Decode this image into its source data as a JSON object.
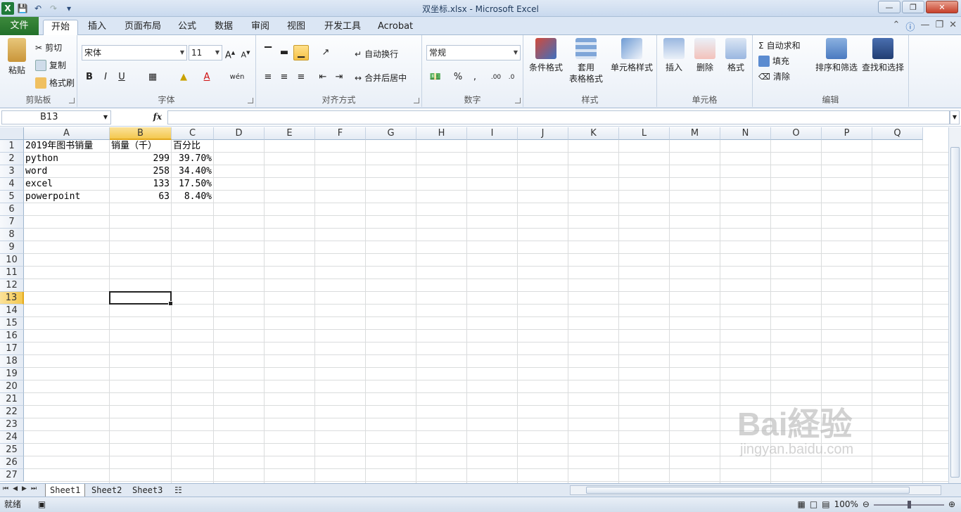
{
  "window": {
    "title": "双坐标.xlsx  -  Microsoft Excel"
  },
  "tabs": [
    "文件",
    "开始",
    "插入",
    "页面布局",
    "公式",
    "数据",
    "审阅",
    "视图",
    "开发工具",
    "Acrobat"
  ],
  "ribbon": {
    "clipboard": {
      "paste": "粘贴",
      "cut": "剪切",
      "copy": "复制",
      "format_painter": "格式刷",
      "label": "剪贴板"
    },
    "font": {
      "name": "宋体",
      "size": "11",
      "label": "字体"
    },
    "alignment": {
      "wrap": "自动换行",
      "merge": "合并后居中",
      "label": "对齐方式"
    },
    "number": {
      "format": "常规",
      "percent": "%",
      "comma": ",",
      "label": "数字"
    },
    "styles": {
      "cond": "条件格式",
      "table1": "套用",
      "table2": "表格格式",
      "cell": "单元格样式",
      "label": "样式"
    },
    "cells": {
      "insert": "插入",
      "delete": "删除",
      "format": "格式",
      "label": "单元格"
    },
    "editing": {
      "autosum": "自动求和",
      "fill": "填充",
      "clear": "清除",
      "sort": "排序和筛选",
      "find": "查找和选择",
      "label": "编辑"
    }
  },
  "formula_bar": {
    "name_box": "B13",
    "fx": "fx",
    "value": ""
  },
  "columns": [
    "A",
    "B",
    "C",
    "D",
    "E",
    "F",
    "G",
    "H",
    "I",
    "J",
    "K",
    "L",
    "M",
    "N",
    "O",
    "P",
    "Q"
  ],
  "rows": [
    "1",
    "2",
    "3",
    "4",
    "5",
    "6",
    "7",
    "8",
    "9",
    "10",
    "11",
    "12",
    "13",
    "14",
    "15",
    "16",
    "17",
    "18",
    "19",
    "20",
    "21",
    "22",
    "23",
    "24",
    "25",
    "26",
    "27"
  ],
  "selected": {
    "column": "B",
    "row": "13"
  },
  "cells": {
    "A1": "2019年图书销量",
    "B1": "销量（千）",
    "C1": "百分比",
    "A2": "python",
    "B2": "299",
    "C2": "39.70%",
    "A3": "word",
    "B3": "258",
    "C3": "34.40%",
    "A4": "excel",
    "B4": "133",
    "C4": "17.50%",
    "A5": "powerpoint",
    "B5": "63",
    "C5": "8.40%"
  },
  "sheets": [
    "Sheet1",
    "Sheet2",
    "Sheet3"
  ],
  "active_sheet": "Sheet1",
  "status": {
    "ready": "就绪",
    "zoom": "100%"
  },
  "watermark": {
    "main": "Bai経验",
    "sub": "jingyan.baidu.com"
  }
}
